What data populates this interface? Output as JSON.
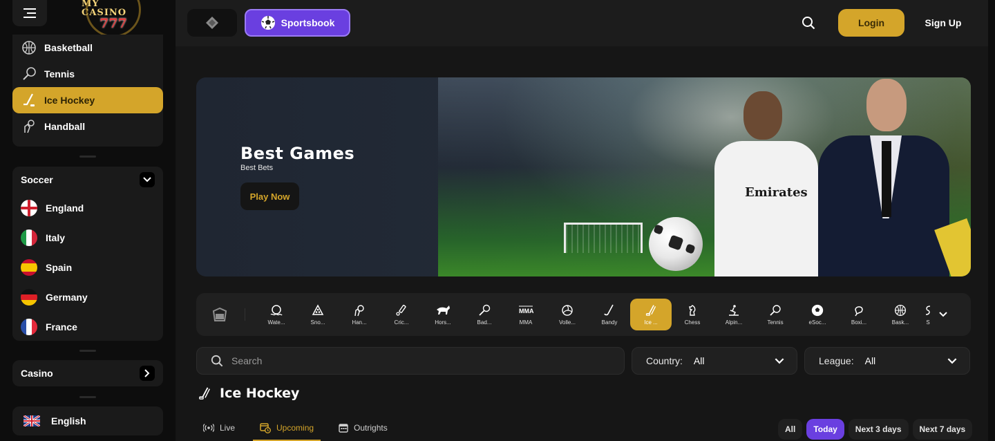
{
  "logo": {
    "line1": "MY CASINO",
    "line2": "777"
  },
  "sidebar": {
    "sports": [
      {
        "label": "Basketball",
        "icon": "basketball-icon"
      },
      {
        "label": "Tennis",
        "icon": "tennis-racket-icon"
      },
      {
        "label": "Ice Hockey",
        "icon": "hockey-stick-icon",
        "active": true
      },
      {
        "label": "Handball",
        "icon": "handball-icon"
      }
    ],
    "soccer": {
      "title": "Soccer",
      "countries": [
        {
          "label": "England",
          "flag": "england-flag-icon"
        },
        {
          "label": "Italy",
          "flag": "italy-flag-icon"
        },
        {
          "label": "Spain",
          "flag": "spain-flag-icon"
        },
        {
          "label": "Germany",
          "flag": "germany-flag-icon"
        },
        {
          "label": "France",
          "flag": "france-flag-icon"
        }
      ]
    },
    "casino_label": "Casino",
    "language": "English"
  },
  "topbar": {
    "sportsbook_label": "Sportsbook",
    "login_label": "Login",
    "signup_label": "Sign Up"
  },
  "banner": {
    "title": "Best Games",
    "subtitle": "Best Bets",
    "cta": "Play Now",
    "jersey_text": "Emirates"
  },
  "sports_strip": [
    {
      "label": "Wate...",
      "icon": "water-polo-icon"
    },
    {
      "label": "Sno...",
      "icon": "snooker-icon"
    },
    {
      "label": "Han...",
      "icon": "handball-icon"
    },
    {
      "label": "Cric...",
      "icon": "cricket-icon"
    },
    {
      "label": "Hors...",
      "icon": "horse-racing-icon"
    },
    {
      "label": "Bad...",
      "icon": "badminton-icon"
    },
    {
      "label": "MMA",
      "icon": "mma-icon"
    },
    {
      "label": "Volle...",
      "icon": "volleyball-icon"
    },
    {
      "label": "Bandy",
      "icon": "bandy-icon"
    },
    {
      "label": "Ice ...",
      "icon": "ice-hockey-icon",
      "active": true
    },
    {
      "label": "Chess",
      "icon": "chess-icon"
    },
    {
      "label": "Alpin...",
      "icon": "alpine-skiing-icon"
    },
    {
      "label": "Tennis",
      "icon": "tennis-icon"
    },
    {
      "label": "eSoc...",
      "icon": "esoccer-icon"
    },
    {
      "label": "Boxi...",
      "icon": "boxing-icon"
    },
    {
      "label": "Bask...",
      "icon": "basketball-icon"
    },
    {
      "label": "S",
      "icon": "sport-icon"
    }
  ],
  "filters": {
    "search_placeholder": "Search",
    "country_label": "Country:",
    "country_value": "All",
    "league_label": "League:",
    "league_value": "All"
  },
  "section_title": "Ice Hockey",
  "tabs": [
    {
      "label": "Live",
      "icon": "live-broadcast-icon"
    },
    {
      "label": "Upcoming",
      "icon": "calendar-clock-icon",
      "active": true
    },
    {
      "label": "Outrights",
      "icon": "calendar-icon"
    }
  ],
  "date_filters": [
    {
      "label": "All"
    },
    {
      "label": "Today",
      "active": true
    },
    {
      "label": "Next 3 days"
    },
    {
      "label": "Next 7 days"
    }
  ],
  "colors": {
    "accent_gold": "#d4a52a",
    "accent_purple": "#6a3fe0",
    "background": "#161616",
    "panel": "#1a1a1a"
  }
}
